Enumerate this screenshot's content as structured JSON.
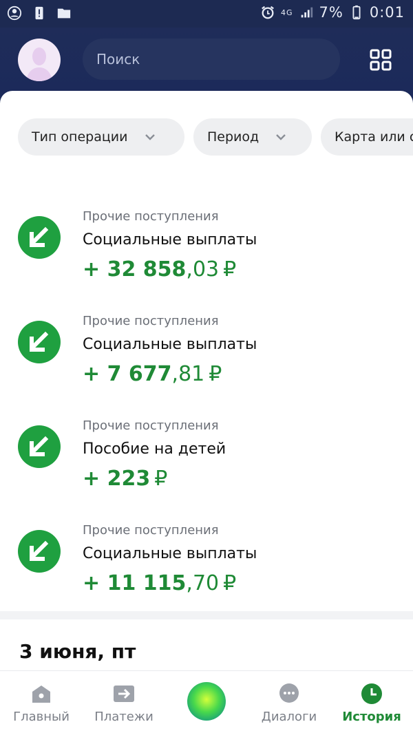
{
  "status_bar": {
    "signal_label": "4G",
    "battery": "7%",
    "time": "0:01"
  },
  "header": {
    "search_placeholder": "Поиск"
  },
  "filters": [
    {
      "label": "Тип операции"
    },
    {
      "label": "Период"
    },
    {
      "label": "Карта или с"
    }
  ],
  "transactions": [
    {
      "category": "Прочие поступления",
      "name": "Социальные выплаты",
      "sign": "+",
      "whole": "32 858",
      "fraction": ",03",
      "currency": "₽"
    },
    {
      "category": "Прочие поступления",
      "name": "Социальные выплаты",
      "sign": "+",
      "whole": "7 677",
      "fraction": ",81",
      "currency": "₽"
    },
    {
      "category": "Прочие поступления",
      "name": "Пособие на детей",
      "sign": "+",
      "whole": "223",
      "fraction": "",
      "currency": "₽"
    },
    {
      "category": "Прочие поступления",
      "name": "Социальные выплаты",
      "sign": "+",
      "whole": "11 115",
      "fraction": ",70",
      "currency": "₽"
    }
  ],
  "section_date": "3 июня, пт",
  "bottom_nav": {
    "items": [
      {
        "label": "Главный",
        "icon": "home-icon"
      },
      {
        "label": "Платежи",
        "icon": "transfer-icon"
      },
      {
        "label": "",
        "icon": "assistant-orb-icon"
      },
      {
        "label": "Диалоги",
        "icon": "chat-icon"
      },
      {
        "label": "История",
        "icon": "clock-icon"
      }
    ],
    "active_index": 4
  },
  "colors": {
    "header_bg": "#1d2a52",
    "accent_green": "#1f8a36",
    "icon_green": "#1fa040"
  }
}
